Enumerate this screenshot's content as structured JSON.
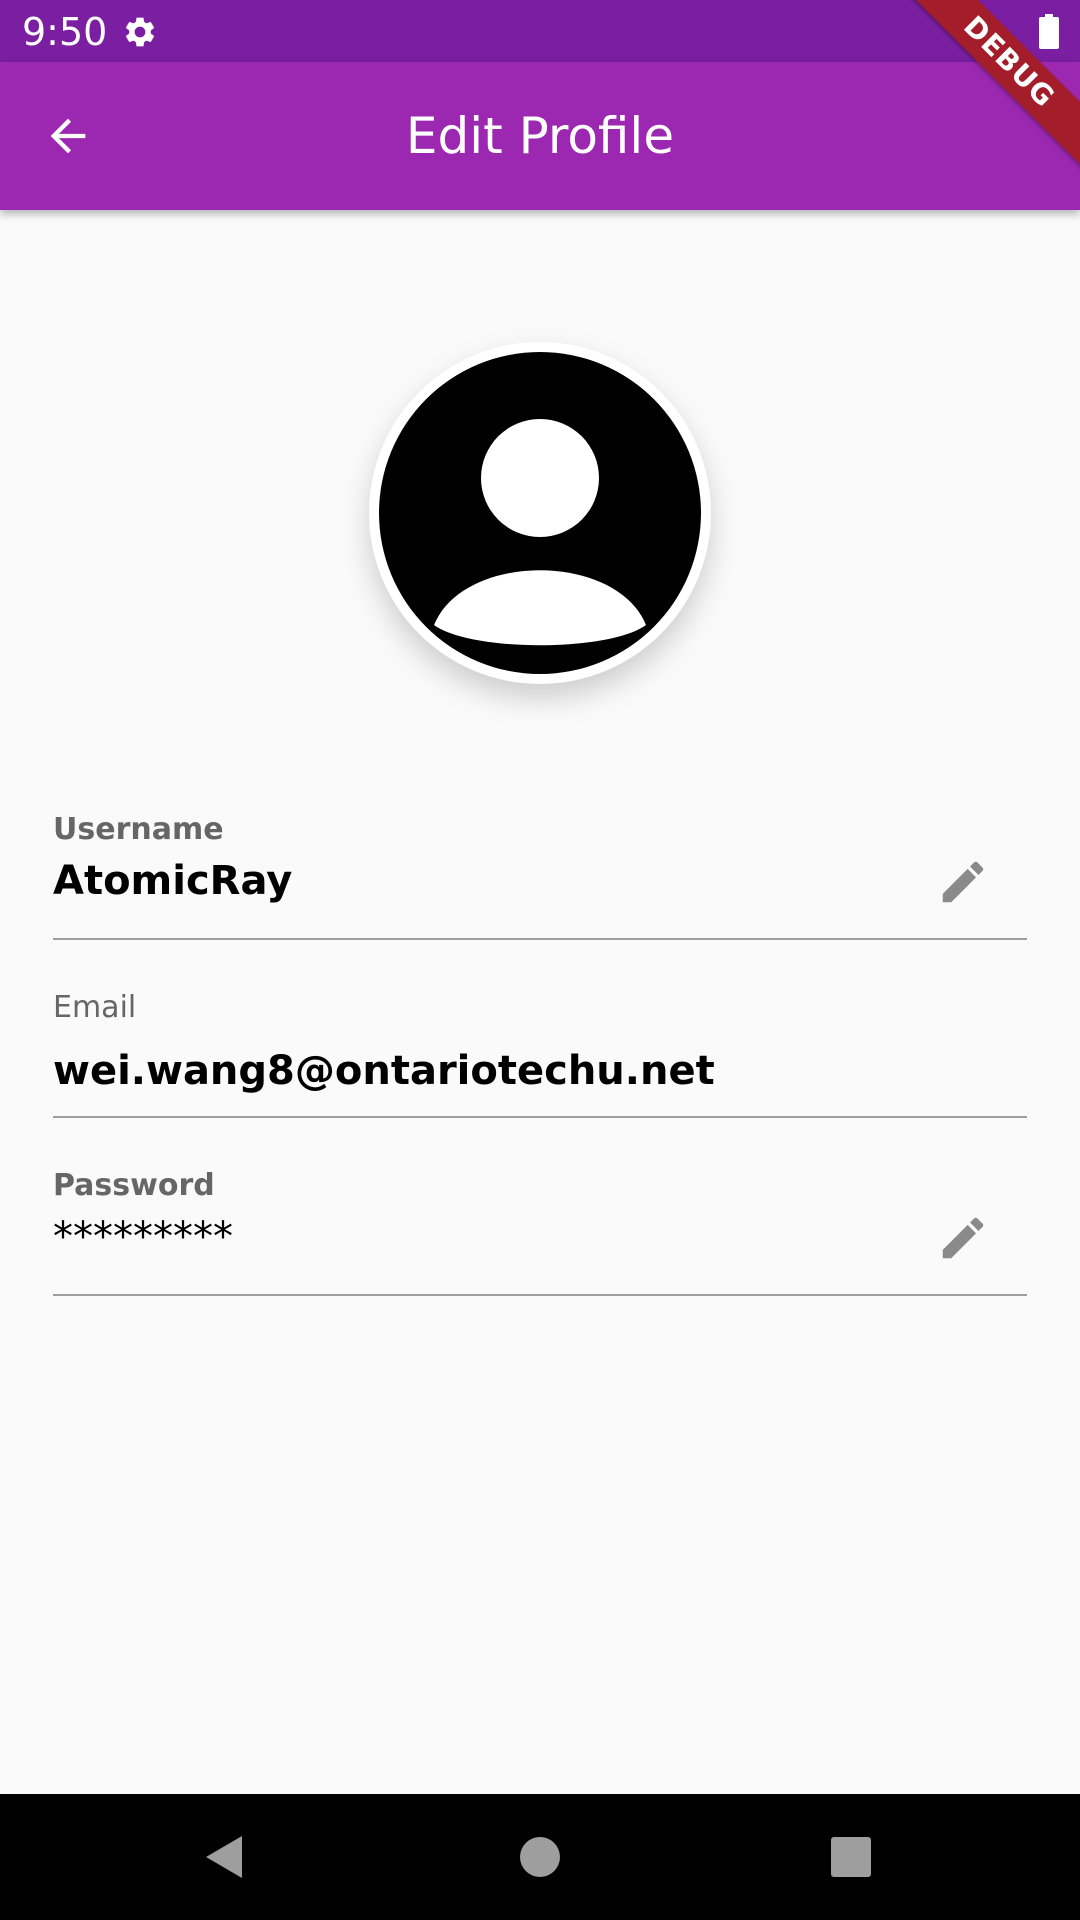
{
  "status_bar": {
    "time": "9:50",
    "icons": [
      "gear-icon",
      "battery-icon"
    ]
  },
  "app_bar": {
    "title": "Edit Profile",
    "back_icon": "arrow-back-icon"
  },
  "debug_banner": "DEBUG",
  "avatar": {
    "icon": "account-circle-icon"
  },
  "fields": {
    "username": {
      "label": "Username",
      "value": "AtomicRay",
      "icon": "pencil-icon"
    },
    "email": {
      "label": "Email",
      "value": "wei.wang8@ontariotechu.net"
    },
    "password": {
      "label": "Password",
      "value": "*********",
      "icon": "pencil-icon"
    }
  },
  "nav_bar": {
    "icons": [
      "back-triangle-icon",
      "home-circle-icon",
      "recents-square-icon"
    ]
  },
  "colors": {
    "status_bar": "#7b1fa2",
    "app_bar": "#9c27b0",
    "background": "#fafafa",
    "debug_ribbon": "#a31d2b",
    "divider": "#9e9e9e",
    "label": "#666666",
    "icon_gray": "#8a8a8a"
  }
}
